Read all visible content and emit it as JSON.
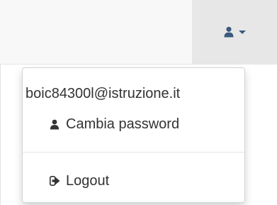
{
  "navbar": {
    "user_icon": "user-icon",
    "caret_icon": "caret-down-icon",
    "accent_color": "#3a5a7e"
  },
  "dropdown": {
    "email": "boic84300l@istruzione.it",
    "items": [
      {
        "label": "Cambia password",
        "icon": "user-icon"
      },
      {
        "label": "Logout",
        "icon": "sign-out-icon"
      }
    ]
  }
}
